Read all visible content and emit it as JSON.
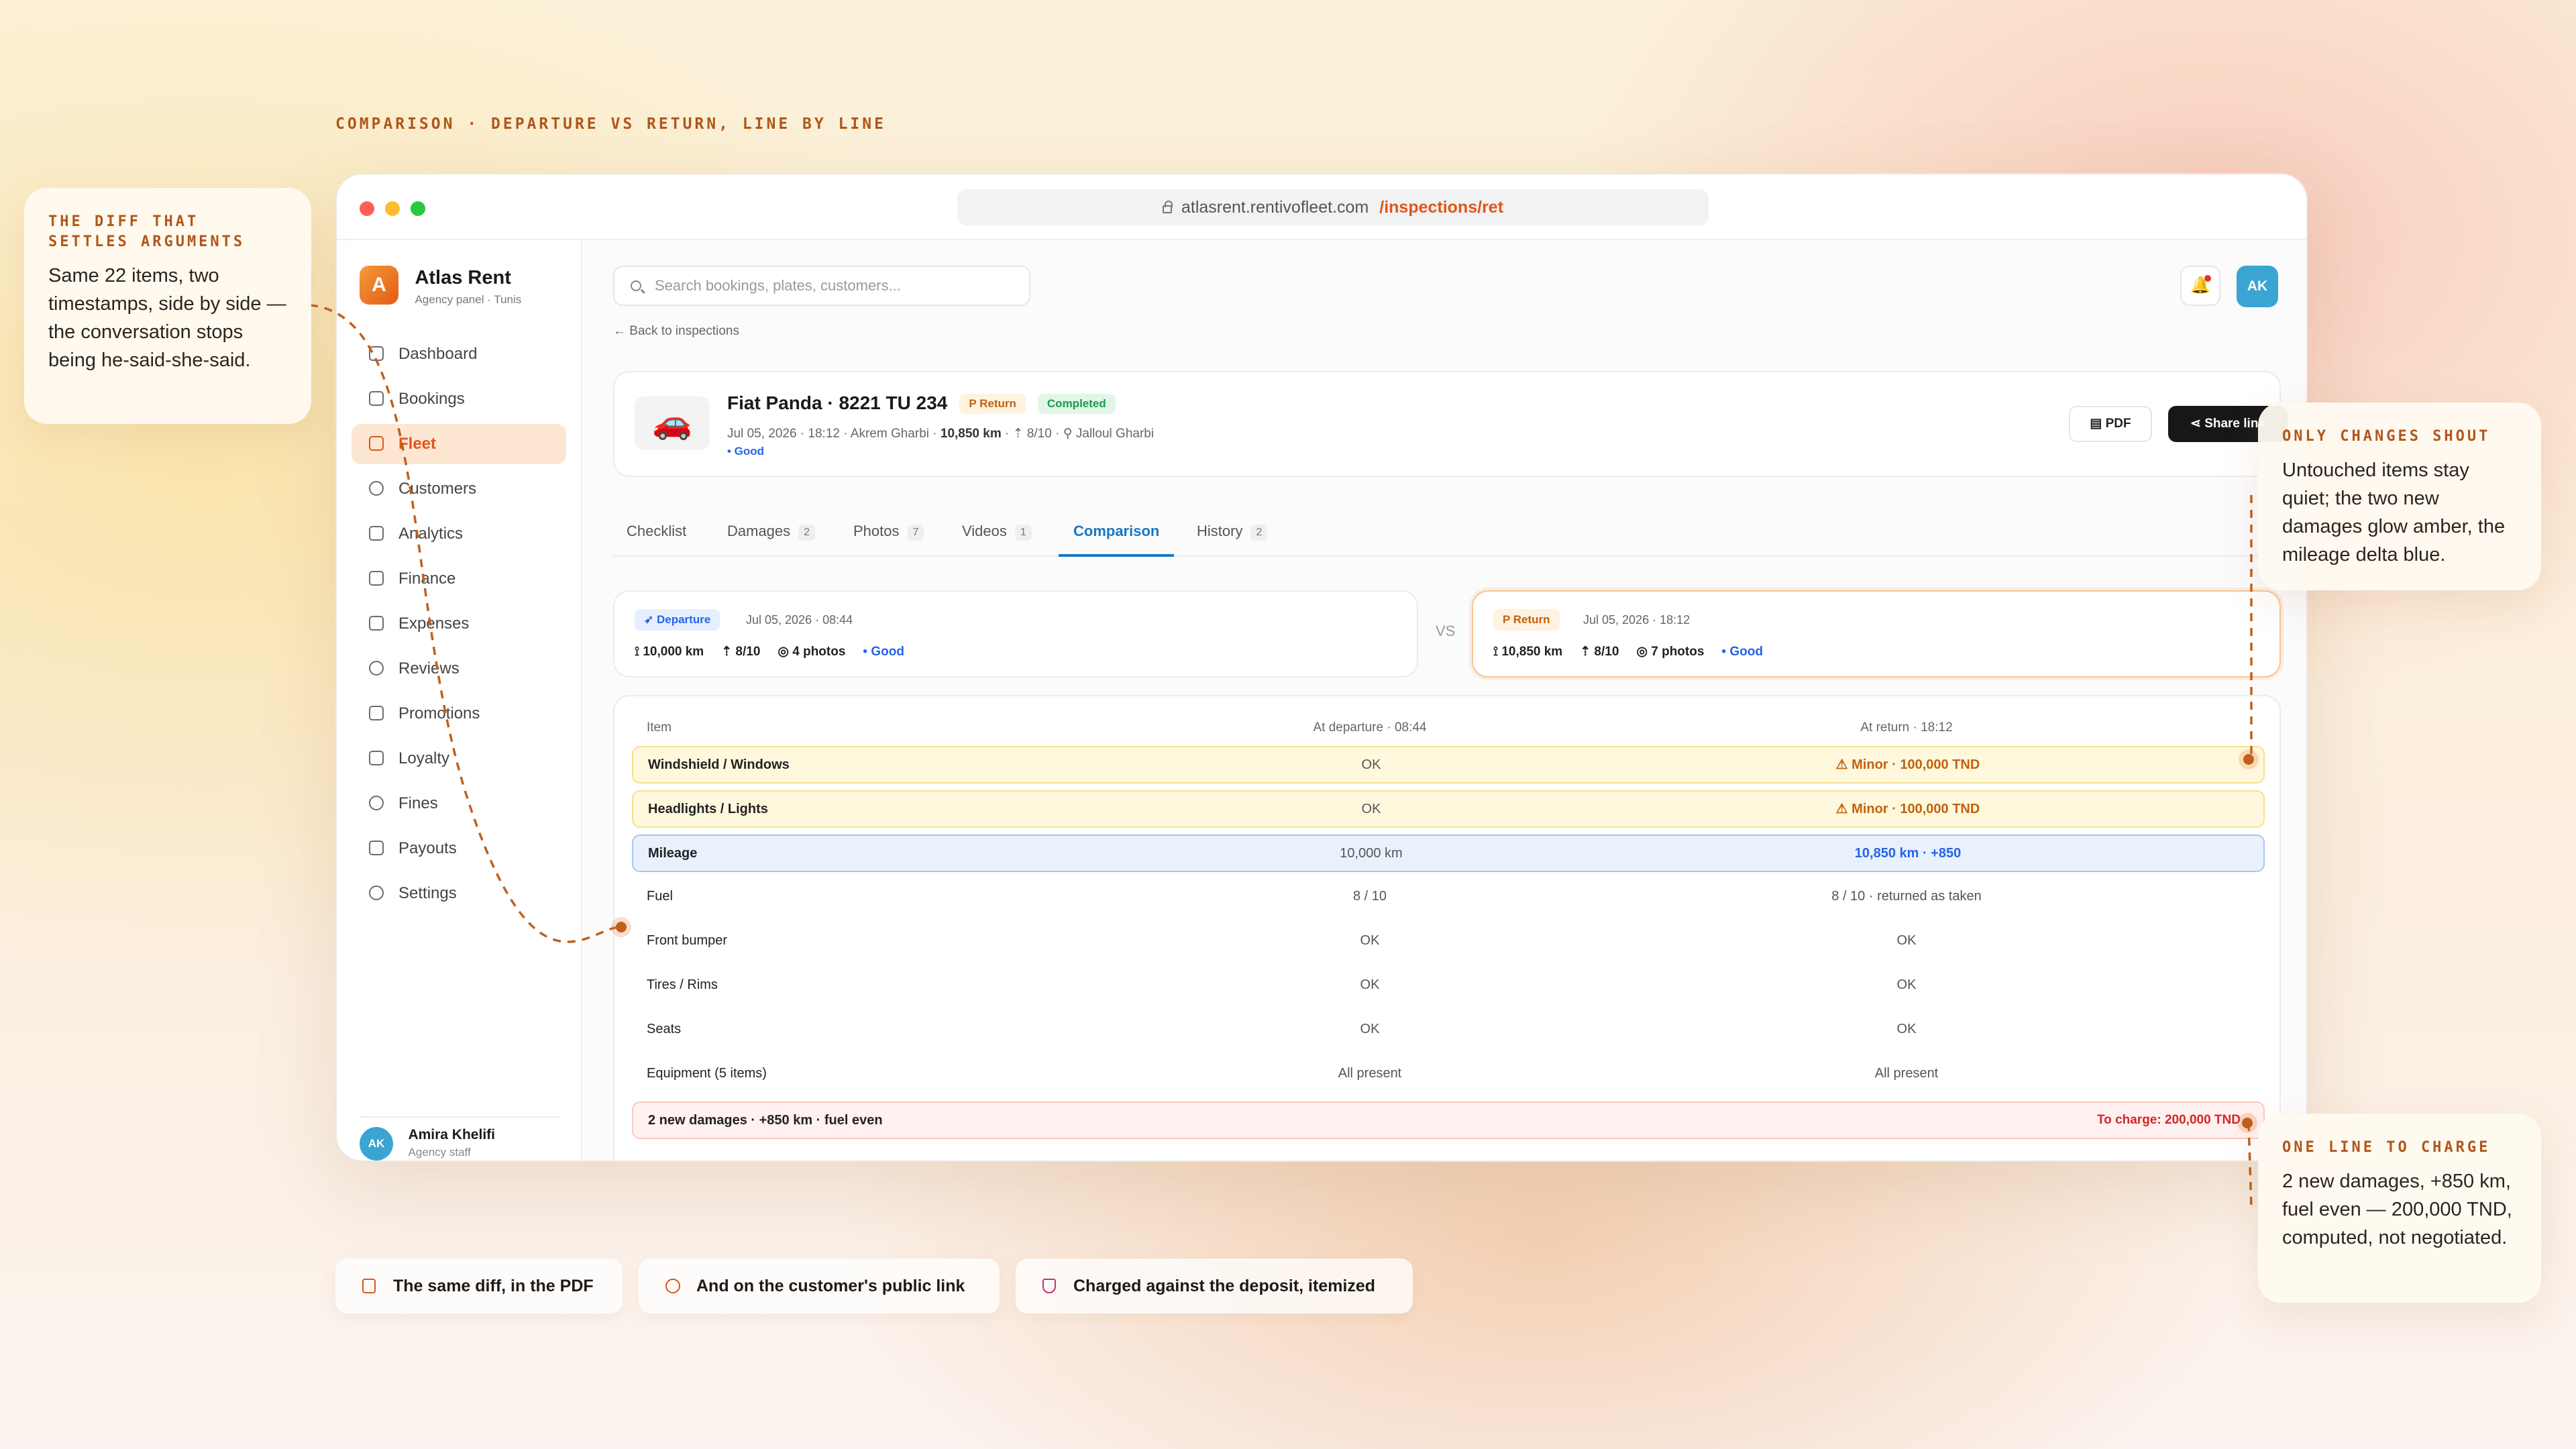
{
  "eyebrow": "COMPARISON · DEPARTURE VS RETURN, LINE BY LINE",
  "browser": {
    "url_host": "atlasrent.rentivofleet.com",
    "url_path": "/inspections/ret"
  },
  "sidebar": {
    "brand_initial": "A",
    "brand_name": "Atlas Rent",
    "brand_sub": "Agency panel · Tunis",
    "items": [
      {
        "label": "Dashboard",
        "icon": "dashboard-icon"
      },
      {
        "label": "Bookings",
        "icon": "calendar-icon"
      },
      {
        "label": "Fleet",
        "icon": "car-icon",
        "active": true
      },
      {
        "label": "Customers",
        "icon": "users-icon"
      },
      {
        "label": "Analytics",
        "icon": "chart-icon"
      },
      {
        "label": "Finance",
        "icon": "money-icon"
      },
      {
        "label": "Expenses",
        "icon": "receipt-icon"
      },
      {
        "label": "Reviews",
        "icon": "star-icon"
      },
      {
        "label": "Promotions",
        "icon": "tag-icon"
      },
      {
        "label": "Loyalty",
        "icon": "crown-icon"
      },
      {
        "label": "Fines",
        "icon": "shield-icon"
      },
      {
        "label": "Payouts",
        "icon": "wallet-icon"
      },
      {
        "label": "Settings",
        "icon": "gear-icon"
      }
    ],
    "user": {
      "initials": "AK",
      "name": "Amira Khelifi",
      "role": "Agency staff"
    }
  },
  "topbar": {
    "search_placeholder": "Search bookings, plates, customers...",
    "avatar": "AK",
    "bell_glyph": "🔔"
  },
  "back_link": "← Back to inspections",
  "inspection": {
    "title": "Fiat Panda · 8221 TU 234",
    "type_badge": "P  Return",
    "status_badge": "Completed",
    "meta_prefix": "Jul 05, 2026 · 18:12 · Akrem Gharbi · ",
    "meta_km": "10,850 km",
    "meta_suffix": " · ⇡ 8/10 · ⚲ Jalloul Gharbi",
    "condition": "• Good",
    "pdf_label": "PDF",
    "share_label": "Share link",
    "car_glyph": "🚗"
  },
  "tabs": [
    {
      "label": "Checklist",
      "count": ""
    },
    {
      "label": "Damages",
      "count": "2"
    },
    {
      "label": "Photos",
      "count": "7"
    },
    {
      "label": "Videos",
      "count": "1"
    },
    {
      "label": "Comparison",
      "count": "",
      "active": true
    },
    {
      "label": "History",
      "count": "2"
    }
  ],
  "departure": {
    "badge": "➶ Departure",
    "date": "Jul 05, 2026 · 08:44",
    "km": "⟟ 10,000 km",
    "fuel": "⇡ 8/10",
    "photos": "◎ 4 photos",
    "condition": "• Good"
  },
  "return_summary": {
    "badge": "P  Return",
    "date": "Jul 05, 2026 · 18:12",
    "km": "⟟ 10,850 km",
    "fuel": "⇡ 8/10",
    "photos": "◎ 7 photos",
    "condition": "• Good"
  },
  "vs_label": "VS",
  "comparison": {
    "headers": {
      "item": "Item",
      "departure": "At departure · 08:44",
      "return": "At return · 18:12"
    },
    "rows": [
      {
        "item": "Windshield / Windows",
        "departure": "OK",
        "return": "⚠ Minor · 100,000 TND",
        "state": "warn"
      },
      {
        "item": "Headlights / Lights",
        "departure": "OK",
        "return": "⚠ Minor · 100,000 TND",
        "state": "warn"
      },
      {
        "item": "Mileage",
        "departure": "10,000 km",
        "return": "10,850 km · +850",
        "state": "info"
      },
      {
        "item": "Fuel",
        "departure": "8 / 10",
        "return": "8 / 10 · returned as taken",
        "state": "plain"
      },
      {
        "item": "Front bumper",
        "departure": "OK",
        "return": "OK",
        "state": "plain"
      },
      {
        "item": "Tires / Rims",
        "departure": "OK",
        "return": "OK",
        "state": "plain"
      },
      {
        "item": "Seats",
        "departure": "OK",
        "return": "OK",
        "state": "plain"
      },
      {
        "item": "Equipment (5 items)",
        "departure": "All present",
        "return": "All present",
        "state": "plain"
      }
    ],
    "summary": "2 new damages · +850 km · fuel even",
    "charge": "To charge: 200,000 TND"
  },
  "callouts": [
    {
      "title": "THE DIFF THAT SETTLES ARGUMENTS",
      "body": "Same 22 items, two timestamps, side by side — the conversation stops being he-said-she-said."
    },
    {
      "title": "ONLY CHANGES SHOUT",
      "body": "Untouched items stay quiet; the two new damages glow amber, the mileage delta blue."
    },
    {
      "title": "ONE LINE TO CHARGE",
      "body": "2 new damages, +850 km, fuel even — 200,000 TND, computed, not negotiated."
    }
  ],
  "features": [
    {
      "label": "The same diff, in the PDF",
      "icon": "document-icon"
    },
    {
      "label": "And on the customer's public link",
      "icon": "share-icon"
    },
    {
      "label": "Charged against the deposit, itemized",
      "icon": "shield-icon"
    }
  ],
  "colors": {
    "accent": "#e0561a",
    "warn": "#c2620f",
    "info": "#2563eb",
    "danger": "#d2262a",
    "success": "#1c9a4a"
  }
}
